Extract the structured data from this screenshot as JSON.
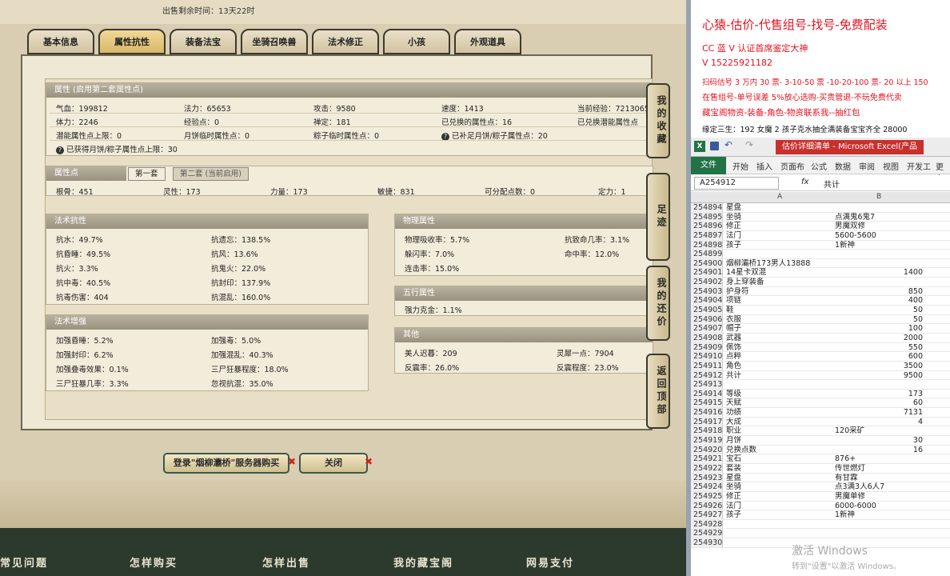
{
  "game": {
    "sale_time_label": "出售剩余时间：",
    "sale_time_value": "13天22时",
    "tabs": [
      {
        "label": "基本信息",
        "active": false
      },
      {
        "label": "属性抗性",
        "active": true
      },
      {
        "label": "装备法宝",
        "active": false
      },
      {
        "label": "坐骑召唤兽",
        "active": false
      },
      {
        "label": "法术修正",
        "active": false
      },
      {
        "label": "小孩",
        "active": false
      },
      {
        "label": "外观道具",
        "active": false
      }
    ],
    "attributes": {
      "title": "属性 (启用第二套属性点)",
      "r1": [
        "气血：199812",
        "法力：65653",
        "攻击：9580",
        "速度：1413",
        "当前经验：7213065"
      ],
      "r2": [
        "体力：2246",
        "经验点：0",
        "禅定：181",
        "已兑换的属性点：16",
        "已兑换潜能属性点"
      ],
      "r3": [
        "潜能属性点上限：0",
        "月饼临时属性点：0",
        "粽子临时属性点：0",
        "已补足月饼/粽子属性点：20"
      ],
      "r4": "已获得月饼/粽子属性点上限：30"
    },
    "points": {
      "title": "属性点",
      "tab1": "第一套",
      "tab2": "第二套 (当前启用)",
      "r1": [
        "根骨：451",
        "灵性：173",
        "力量：173",
        "敏捷：831",
        "可分配点数：0",
        "定力：1"
      ]
    },
    "resist": {
      "title": "法术抗性",
      "left": [
        "抗水：49.7%",
        "抗昏睡：49.5%",
        "抗火：3.3%",
        "抗中毒：40.5%",
        "抗毒伤害：404"
      ],
      "right": [
        "抗遗忘：138.5%",
        "抗风：13.6%",
        "抗鬼火：22.0%",
        "抗封印：137.9%",
        "抗混乱：160.0%"
      ]
    },
    "physical": {
      "title": "物理属性",
      "left": [
        "物理吸收率：5.7%",
        "躲闪率：7.0%",
        "连击率：15.0%"
      ],
      "right": [
        "抗致命几率：3.1%",
        "命中率：12.0%"
      ]
    },
    "wuxing": {
      "title": "五行属性",
      "r1": "强力克金：1.1%"
    },
    "boost": {
      "title": "法术增强",
      "left": [
        "加强昏睡：5.2%",
        "加强封印：6.2%",
        "加强叠毒效果：0.1%",
        "三尸狂暴几率：3.3%"
      ],
      "right": [
        "加强毒：5.0%",
        "加强混乱：40.3%",
        "三尸狂暴程度：18.0%",
        "忽视抗混：35.0%"
      ]
    },
    "other": {
      "title": "其他",
      "left": [
        "美人迟暮：209",
        "反震率：26.0%"
      ],
      "right": [
        "灵犀一点：7904",
        "反震程度：23.0%"
      ]
    },
    "side_tabs": [
      "我的收藏",
      "足迹",
      "我的还价",
      "返回顶部"
    ],
    "login_button": "登录\"烟柳灞桥\"服务器购买",
    "close_button": "关闭",
    "footer": [
      "常见问题",
      "怎样购买",
      "怎样出售",
      "我的藏宝阁",
      "网易支付"
    ]
  },
  "ads": {
    "title": "心猿-估价-代售组号-找号-免费配装",
    "l1": "CC 蓝 V 认证首席鉴定大神",
    "l2": "V 15225921182",
    "l3": "扫码估号 3 万内 30 票- 3-10-50 票 -10-20-100 票- 20 以上 150",
    "l4": "在售组号-单号误差 5%放心选购-买贵管退-不玩免费代卖",
    "l5": "藏宝阁物资-装备-角色-物资联系我--抽红包",
    "l6": "缘定三生：192 女魔 2 孩子克水抽全满装备宝宝齐全 28000"
  },
  "excel": {
    "doc_title": "估价详细清单 - Microsoft Excel(产品",
    "ribbon_file": "文件",
    "ribbon": [
      "开始",
      "插入",
      "页面布",
      "公式",
      "数据",
      "审阅",
      "视图",
      "开发工",
      "更多"
    ],
    "name_box": "A254912",
    "fx": "fx",
    "formula": "共计",
    "col_a": "A",
    "col_b": "B",
    "rows": [
      [
        "254894",
        "星盘",
        ""
      ],
      [
        "254895",
        "坐骑",
        "点满鬼6鬼7"
      ],
      [
        "254896",
        "修正",
        "男魔双修"
      ],
      [
        "254897",
        "法门",
        "5600-5600"
      ],
      [
        "254898",
        "孩子",
        "1新神"
      ],
      [
        "254899",
        "",
        ""
      ],
      [
        "254900",
        "烟柳灞桥173男人13888",
        ""
      ],
      [
        "254901",
        "14星卡双混",
        "1400"
      ],
      [
        "254902",
        "身上穿装备",
        ""
      ],
      [
        "254903",
        "护身符",
        "850"
      ],
      [
        "254904",
        "项链",
        "400"
      ],
      [
        "254905",
        "鞋",
        "50"
      ],
      [
        "254906",
        "衣服",
        "50"
      ],
      [
        "254907",
        "帽子",
        "100"
      ],
      [
        "254908",
        "武器",
        "2000"
      ],
      [
        "254909",
        "佩饰",
        "550"
      ],
      [
        "254910",
        "点粹",
        "600"
      ],
      [
        "254911",
        "角色",
        "3500"
      ],
      [
        "254912",
        "共计",
        "9500"
      ],
      [
        "254913",
        "",
        ""
      ],
      [
        "254914",
        "等级",
        "173"
      ],
      [
        "254915",
        "天赋",
        "60"
      ],
      [
        "254916",
        "功绩",
        "7131"
      ],
      [
        "254917",
        "大成",
        "4"
      ],
      [
        "254918",
        "职业",
        "120采矿"
      ],
      [
        "254919",
        "月饼",
        "30"
      ],
      [
        "254920",
        "兑换点数",
        "16"
      ],
      [
        "254921",
        "宝石",
        "876+"
      ],
      [
        "254922",
        "套装",
        "传世燃灯"
      ],
      [
        "254923",
        "星盘",
        "有甘霖"
      ],
      [
        "254924",
        "坐骑",
        "点3满3人6人7"
      ],
      [
        "254925",
        "修正",
        "男魔单修"
      ],
      [
        "254926",
        "法门",
        "6000-6000"
      ],
      [
        "254927",
        "孩子",
        "1新神"
      ],
      [
        "254928",
        "",
        ""
      ],
      [
        "254929",
        "",
        ""
      ],
      [
        "254930",
        "",
        ""
      ]
    ],
    "watermark": "激活 Windows",
    "watermark_sub": "转到\"设置\"以激活 Windows。"
  }
}
